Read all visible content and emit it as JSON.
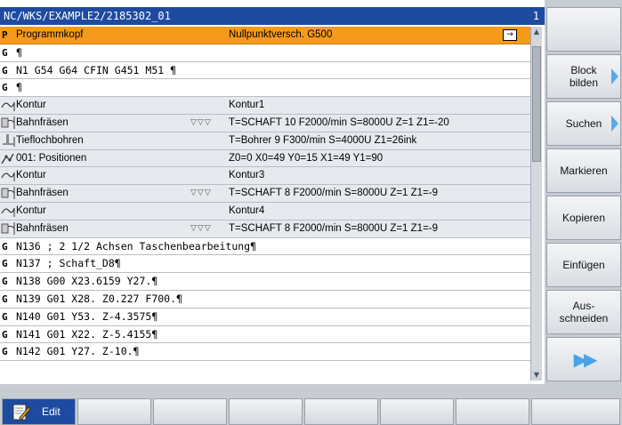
{
  "title": {
    "path": "NC/WKS/EXAMPLE2/2185302_01",
    "channel": "1"
  },
  "rows": [
    {
      "mark": "P",
      "col1": "Programmkopf",
      "col3": "Nullpunktversch. G500",
      "type": "sel"
    },
    {
      "mark": "G",
      "code": "¶",
      "type": "code"
    },
    {
      "mark": "G",
      "code": "N1 G54 G64 CFIN G451 M51 ¶",
      "type": "code"
    },
    {
      "mark": "G",
      "code": "¶",
      "type": "code"
    },
    {
      "icon": "contour-icon",
      "col1": "Kontur",
      "col3": "Kontur1",
      "type": "cyc"
    },
    {
      "icon": "path-milling-icon",
      "col1": "Bahnfräsen",
      "col2": "▽▽▽",
      "col3": "T=SCHAFT 10 F2000/min S=8000U Z=1 Z1=-20",
      "type": "cyc"
    },
    {
      "icon": "deep-drilling-icon",
      "col1": "Tieflochbohren",
      "col3": "T=Bohrer 9 F300/min S=4000U Z1=26ink",
      "type": "cyc"
    },
    {
      "icon": "positions-icon",
      "col1": "001: Positionen",
      "col3": "Z0=0 X0=49 Y0=15 X1=49 Y1=90",
      "type": "cyc"
    },
    {
      "icon": "contour-icon",
      "col1": "Kontur",
      "col3": "Kontur3",
      "type": "cyc"
    },
    {
      "icon": "path-milling-icon",
      "col1": "Bahnfräsen",
      "col2": "▽▽▽",
      "col3": "T=SCHAFT 8 F2000/min S=8000U Z=1 Z1=-9",
      "type": "cyc"
    },
    {
      "icon": "contour-icon",
      "col1": "Kontur",
      "col3": "Kontur4",
      "type": "cyc"
    },
    {
      "icon": "path-milling-icon",
      "col1": "Bahnfräsen",
      "col2": "▽▽▽",
      "col3": "T=SCHAFT 8 F2000/min S=8000U Z=1 Z1=-9",
      "type": "cyc"
    },
    {
      "mark": "G",
      "code": "N136 ; 2 1/2 Achsen Taschenbearbeitung¶",
      "type": "code"
    },
    {
      "mark": "G",
      "code": "N137 ; Schaft_D8¶",
      "type": "code"
    },
    {
      "mark": "G",
      "code": "N138 G00 X23.6159 Y27.¶",
      "type": "code"
    },
    {
      "mark": "G",
      "code": "N139 G01 X28. Z0.227 F700.¶",
      "type": "code"
    },
    {
      "mark": "G",
      "code": "N140 G01 Y53. Z-4.3575¶",
      "type": "code"
    },
    {
      "mark": "G",
      "code": "N141 G01 X22. Z-5.4155¶",
      "type": "code"
    },
    {
      "mark": "G",
      "code": "N142 G01 Y27. Z-10.¶",
      "type": "code"
    }
  ],
  "softkeys": {
    "block_bilden": "Block bilden",
    "suchen": "Suchen",
    "markieren": "Markieren",
    "kopieren": "Kopieren",
    "einfuegen": "Einfügen",
    "ausschneiden_1": "Aus-",
    "ausschneiden_2": "schneiden"
  },
  "bottom": {
    "edit_label": "Edit"
  },
  "colors": {
    "title_bg": "#1e4ba0",
    "selection": "#f59a1a",
    "arrow": "#5aa9e6"
  }
}
